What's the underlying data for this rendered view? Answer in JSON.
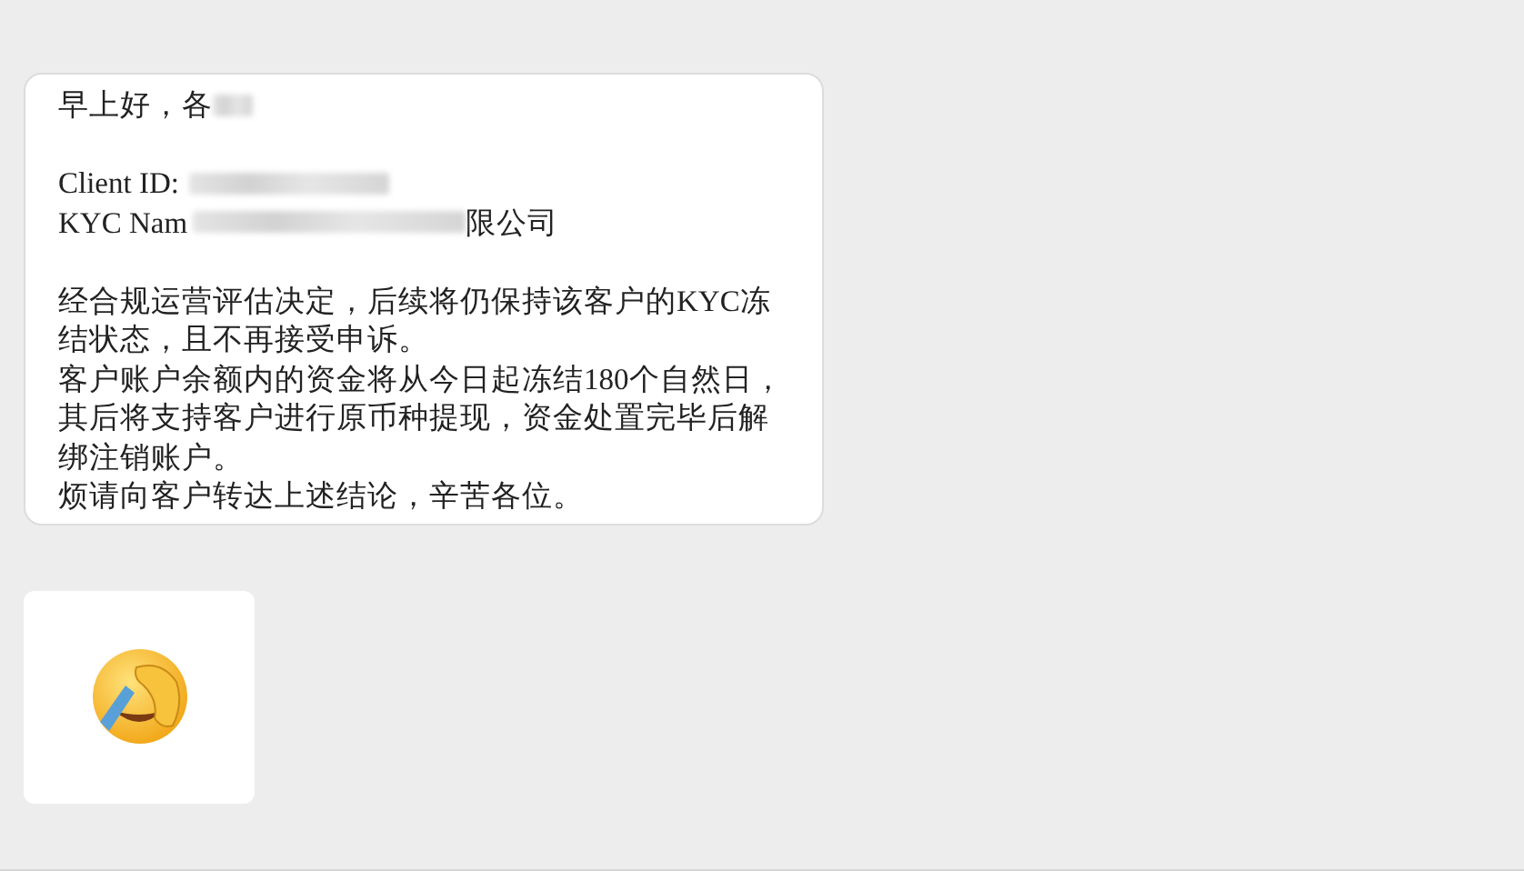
{
  "messages": [
    {
      "kind": "text",
      "greeting": "早上好，各",
      "client_id_label": "Client ID:",
      "kyc_label": "KYC Nam",
      "kyc_suffix": "限公司",
      "paragraphs": [
        "经合规运营评估决定，后续将仍保持该客户的KYC冻结状态，且不再接受申诉。",
        "客户账户余额内的资金将从今日起冻结180个自然日，其后将支持客户进行原币种提现，资金处置完毕后解绑注销账户。",
        "烦请向客户转达上述结论，辛苦各位。"
      ]
    },
    {
      "kind": "sticker"
    }
  ]
}
